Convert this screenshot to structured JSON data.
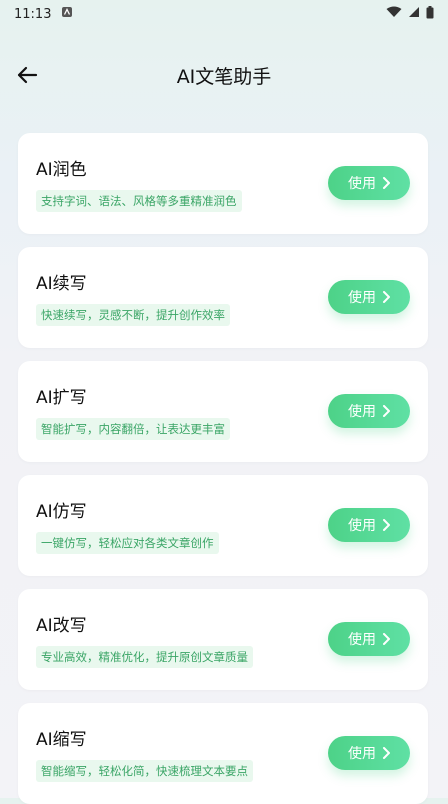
{
  "status": {
    "time": "11:13"
  },
  "header": {
    "title": "AI文笔助手"
  },
  "cards": [
    {
      "name": "AI润色",
      "desc": "支持字词、语法、风格等多重精准润色",
      "button": "使用"
    },
    {
      "name": "AI续写",
      "desc": "快速续写，灵感不断，提升创作效率",
      "button": "使用"
    },
    {
      "name": "AI扩写",
      "desc": "智能扩写，内容翻倍，让表达更丰富",
      "button": "使用"
    },
    {
      "name": "AI仿写",
      "desc": "一键仿写，轻松应对各类文章创作",
      "button": "使用"
    },
    {
      "name": "AI改写",
      "desc": "专业高效，精准优化，提升原创文章质量",
      "button": "使用"
    },
    {
      "name": "AI缩写",
      "desc": "智能缩写，轻松化简，快速梳理文本要点",
      "button": "使用"
    }
  ],
  "colors": {
    "accent": "#4dd288",
    "tag_bg": "#e9f8ee",
    "tag_text": "#3aa566"
  }
}
